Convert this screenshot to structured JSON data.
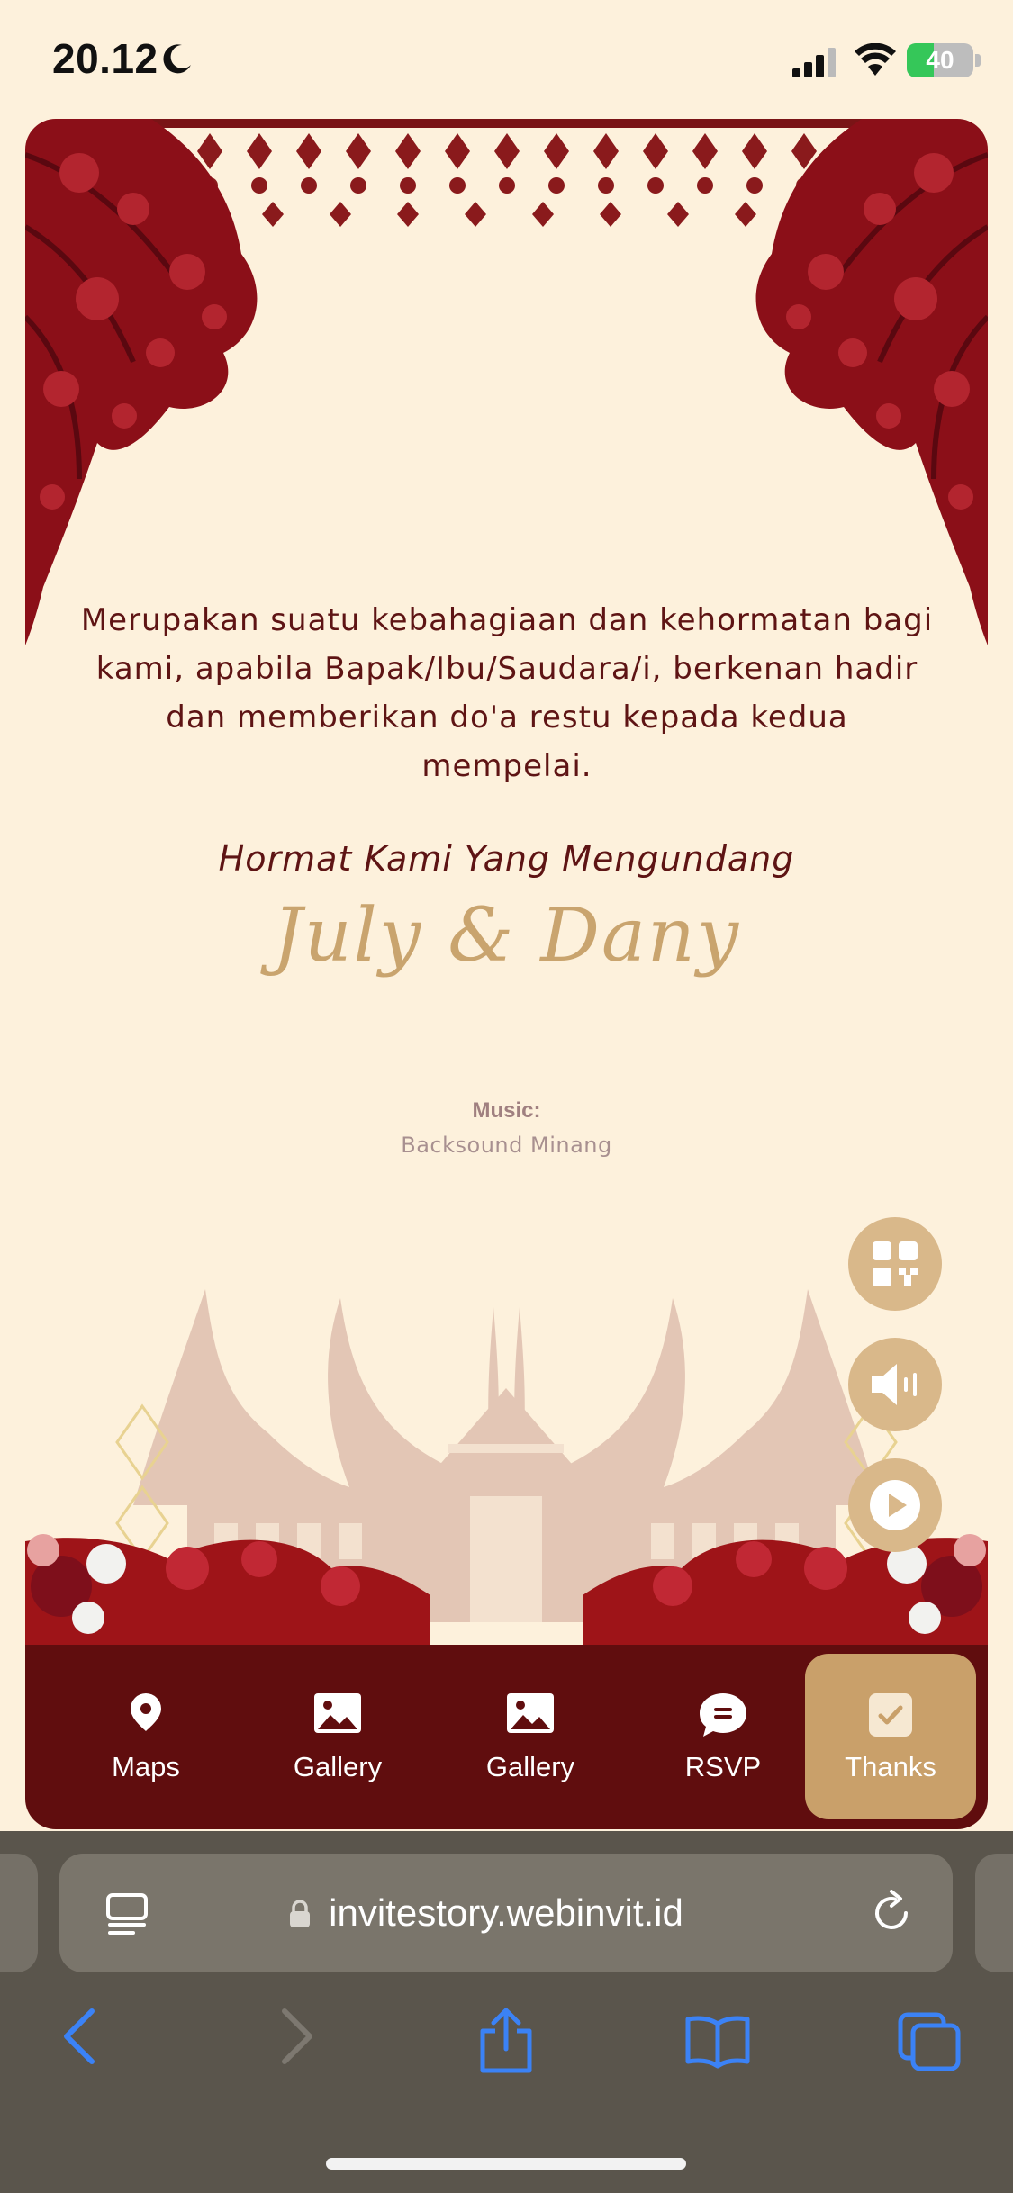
{
  "status_bar": {
    "time": "20.12",
    "battery_percent": 40,
    "battery_label": "40"
  },
  "invitation": {
    "message": "Merupakan suatu kebahagiaan dan kehormatan bagi kami, apabila Bapak/Ibu/Saudara/i, berkenan hadir dan memberikan do'a restu kepada kedua mempelai.",
    "closing": "Hormat Kami Yang Mengundang",
    "couple": "July & Dany"
  },
  "music": {
    "label": "Music:",
    "title": "Backsound Minang"
  },
  "floating_buttons": [
    {
      "name": "qr-code-button",
      "icon": "qr-code-icon"
    },
    {
      "name": "sound-toggle-button",
      "icon": "speaker-icon"
    },
    {
      "name": "autoscroll-play-button",
      "icon": "play-icon"
    }
  ],
  "nav": {
    "items": [
      {
        "label": "Maps",
        "icon": "map-pin-icon"
      },
      {
        "label": "Gallery",
        "icon": "image-icon"
      },
      {
        "label": "Gallery",
        "icon": "image-icon"
      },
      {
        "label": "RSVP",
        "icon": "chat-icon"
      },
      {
        "label": "Thanks",
        "icon": "check-icon"
      }
    ],
    "active_index": 4
  },
  "browser": {
    "url": "invitestory.webinvit.id"
  },
  "colors": {
    "background": "#fdf1dc",
    "maroon": "#600d0e",
    "gold": "#c9a46e",
    "fab": "#d9b88a",
    "active_tab": "#c9a06a",
    "browser_chrome": "#5a554c",
    "ios_blue": "#3b82f6"
  }
}
